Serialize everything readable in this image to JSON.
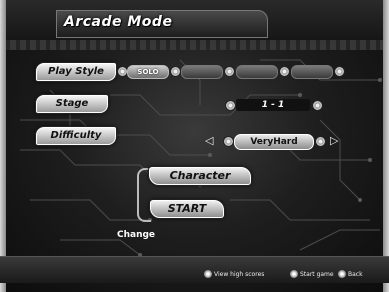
{
  "header": {
    "title": "Arcade Mode"
  },
  "menu": {
    "play_style": {
      "label": "Play Style",
      "options": [
        "SOLO",
        "",
        "",
        ""
      ],
      "selected_index": 0
    },
    "stage": {
      "label": "Stage",
      "value": "1 - 1"
    },
    "difficulty": {
      "label": "Difficulty",
      "value": "VeryHard",
      "left_arrow": "◁",
      "right_arrow": "▷"
    },
    "character_button": {
      "label": "Character"
    },
    "start_button": {
      "label": "START"
    },
    "change_text": "Change"
  },
  "footer": {
    "hints": [
      {
        "label": "View high scores"
      },
      {
        "label": "Start game"
      },
      {
        "label": "Back"
      }
    ]
  }
}
